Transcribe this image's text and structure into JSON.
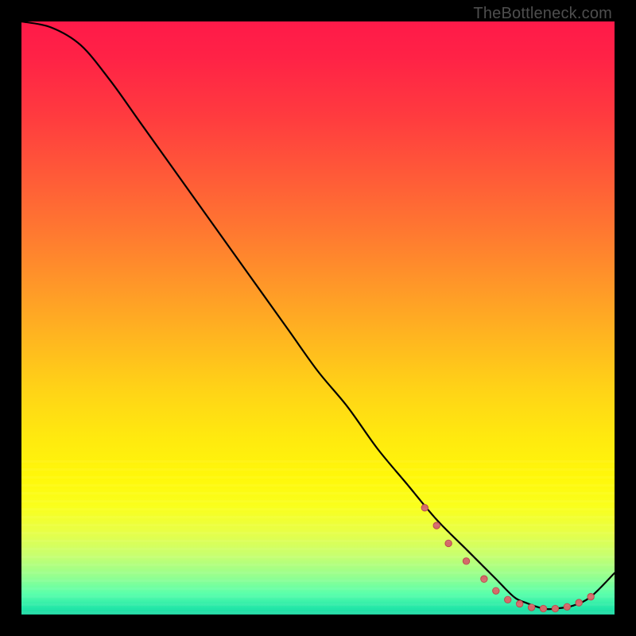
{
  "watermark": "TheBottleneck.com",
  "colors": {
    "dot_fill": "#d46a6a",
    "dot_stroke": "#b94b4b",
    "line": "#000000"
  },
  "chart_data": {
    "type": "line",
    "title": "",
    "xlabel": "",
    "ylabel": "",
    "xlim": [
      0,
      100
    ],
    "ylim": [
      0,
      100
    ],
    "note": "Y value = bottleneck % (0 at bottom/green, 100 at top/red). Curve is approximate, read from pixels.",
    "series": [
      {
        "name": "bottleneck-curve",
        "x": [
          0,
          5,
          10,
          15,
          20,
          25,
          30,
          35,
          40,
          45,
          50,
          55,
          60,
          65,
          70,
          75,
          80,
          83,
          85,
          88,
          90,
          93,
          96,
          100
        ],
        "y": [
          100,
          99,
          96,
          90,
          83,
          76,
          69,
          62,
          55,
          48,
          41,
          35,
          28,
          22,
          16,
          11,
          6,
          3,
          2,
          1,
          1,
          1.5,
          3,
          7
        ]
      }
    ],
    "markers": {
      "name": "optimal-range-dots",
      "x": [
        68,
        70,
        72,
        75,
        78,
        80,
        82,
        84,
        86,
        88,
        90,
        92,
        94,
        96
      ],
      "y": [
        18,
        15,
        12,
        9,
        6,
        4,
        2.5,
        1.8,
        1.2,
        1.0,
        1.0,
        1.3,
        2.0,
        3.0
      ]
    }
  }
}
